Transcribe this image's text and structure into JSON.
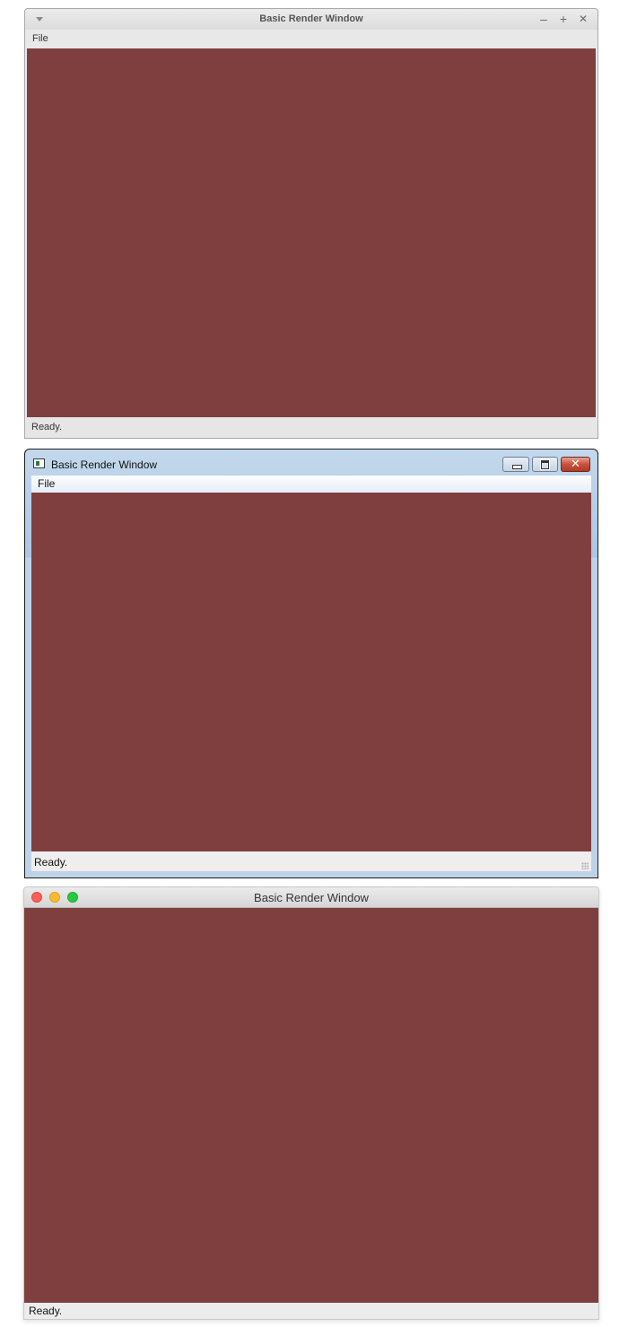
{
  "canvas_color": "#7f3f3f",
  "windows": [
    {
      "style": "linux",
      "title": "Basic Render Window",
      "menu": {
        "file_label": "File"
      },
      "buttons": {
        "minimize": "–",
        "maximize": "+",
        "close": "✕"
      },
      "status": "Ready."
    },
    {
      "style": "windows",
      "title": "Basic Render Window",
      "menu": {
        "file_label": "File"
      },
      "buttons": {
        "close": "✕"
      },
      "status": "Ready."
    },
    {
      "style": "macos",
      "title": "Basic Render Window",
      "status": "Ready."
    }
  ]
}
